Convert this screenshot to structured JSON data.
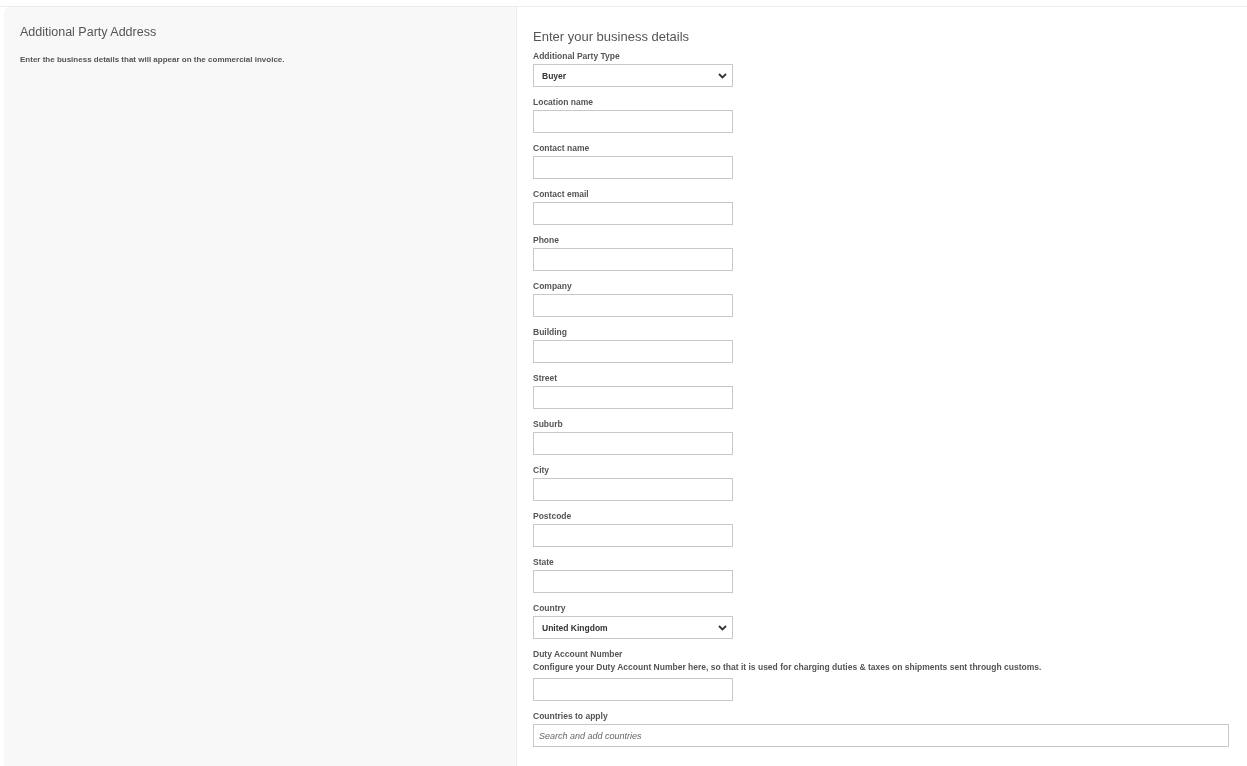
{
  "sidebar": {
    "title": "Additional Party Address",
    "description": "Enter the business details that will appear on the commercial invoice."
  },
  "form": {
    "heading": "Enter your business details",
    "fields": [
      {
        "kind": "select",
        "label": "Additional Party Type",
        "value": "Buyer"
      },
      {
        "kind": "text",
        "label": "Location name"
      },
      {
        "kind": "text",
        "label": "Contact name"
      },
      {
        "kind": "text",
        "label": "Contact email"
      },
      {
        "kind": "text",
        "label": "Phone"
      },
      {
        "kind": "text",
        "label": "Company"
      },
      {
        "kind": "text",
        "label": "Building"
      },
      {
        "kind": "text",
        "label": "Street"
      },
      {
        "kind": "text",
        "label": "Suburb"
      },
      {
        "kind": "text",
        "label": "City"
      },
      {
        "kind": "text",
        "label": "Postcode"
      },
      {
        "kind": "text",
        "label": "State"
      },
      {
        "kind": "select",
        "label": "Country",
        "value": "United Kingdom"
      },
      {
        "kind": "text",
        "label": "Duty Account Number",
        "help": "Configure your Duty Account Number here, so that it is used for charging duties & taxes on shipments sent through customs."
      },
      {
        "kind": "search",
        "label": "Countries to apply",
        "placeholder": "Search and add countries"
      }
    ]
  }
}
